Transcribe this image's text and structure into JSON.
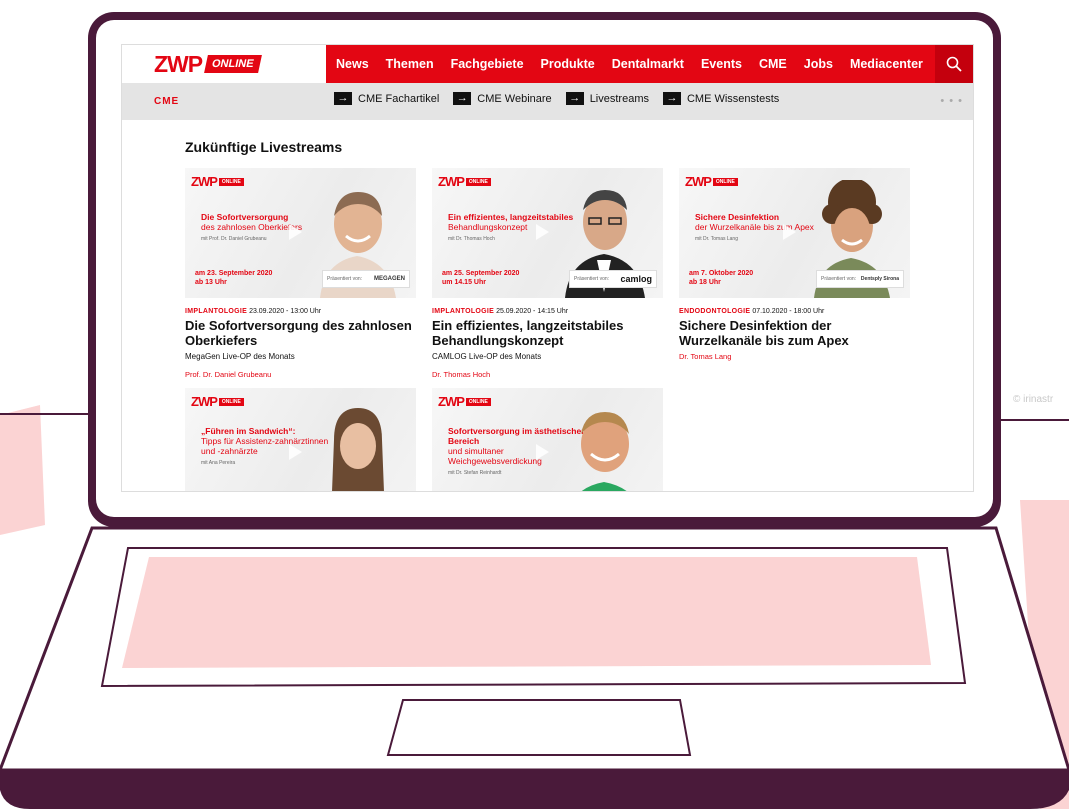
{
  "watermark": "© irinastr",
  "header": {
    "logo_main": "ZWP",
    "logo_badge": "ONLINE",
    "nav": [
      "News",
      "Themen",
      "Fachgebiete",
      "Produkte",
      "Dentalmarkt",
      "Events",
      "CME",
      "Jobs",
      "Mediacenter"
    ],
    "search_icon": "search-icon"
  },
  "subnav": {
    "section": "CME",
    "items": [
      "CME Fachartikel",
      "CME Webinare",
      "Livestreams",
      "CME Wissenstests"
    ],
    "arrow_glyph": "→",
    "more": "• • •"
  },
  "main": {
    "title": "Zukünftige Livestreams",
    "cards": [
      {
        "thumb_head1": "Die Sofortversorgung",
        "thumb_head2": "des zahnlosen Oberkiefers",
        "thumb_speaker": "mit Prof. Dr. Daniel Grubeanu",
        "thumb_date1": "am 23. September 2020",
        "thumb_date2": "ab 13 Uhr",
        "presented": "Präsentiert von:",
        "sponsor": "MEGAGEN",
        "category": "IMPLANTOLOGIE",
        "datetime": "23.09.2020 - 13:00 Uhr",
        "title": "Die Sofortversorgung des zahnlosen Oberkiefers",
        "subtitle": "MegaGen Live-OP des Monats",
        "author": "Prof. Dr. Daniel Grubeanu"
      },
      {
        "thumb_head1": "Ein effizientes, langzeitstabiles",
        "thumb_head2": "Behandlungskonzept",
        "thumb_speaker": "mit Dr. Thomas Hoch",
        "thumb_date1": "am 25. September 2020",
        "thumb_date2": "um 14.15 Uhr",
        "presented": "Präsentiert von:",
        "sponsor": "camlog",
        "category": "IMPLANTOLOGIE",
        "datetime": "25.09.2020 - 14:15 Uhr",
        "title": "Ein effizientes, langzeitstabiles Behandlungskonzept",
        "subtitle": "CAMLOG Live-OP des Monats",
        "author": "Dr. Thomas Hoch"
      },
      {
        "thumb_head1": "Sichere Desinfektion",
        "thumb_head2": "der Wurzelkanäle bis zum Apex",
        "thumb_speaker": "mit Dr. Tomas Lang",
        "thumb_date1": "am 7. Oktober 2020",
        "thumb_date2": "ab 18 Uhr",
        "presented": "Präsentiert von:",
        "sponsor": "Dentsply Sirona",
        "category": "ENDODONTOLOGIE",
        "datetime": "07.10.2020 - 18:00 Uhr",
        "title": "Sichere Desinfektion der Wurzelkanäle bis zum Apex",
        "subtitle": "",
        "author": "Dr. Tomas Lang"
      },
      {
        "thumb_head1": "„Führen im Sandwich“:",
        "thumb_head2": "Tipps für Assistenz-zahnärztinnen und -zahnärzte",
        "thumb_speaker": "mit Ana Pereira"
      },
      {
        "thumb_head1": "Sofortversorgung im ästhetischen Bereich",
        "thumb_head2": "und simultaner Weichgewebsverdickung",
        "thumb_speaker": "mit Dr. Stefan Reinhardt"
      }
    ]
  },
  "colors": {
    "brand_red": "#e30613",
    "laptop_outline": "#4a1a3a",
    "accent_pink": "#fbd3d3"
  }
}
